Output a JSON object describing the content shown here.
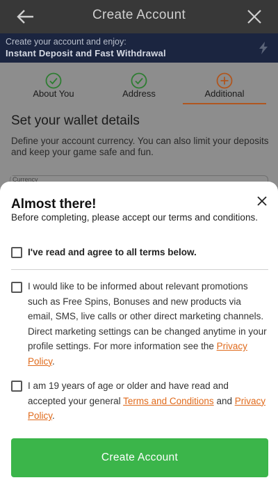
{
  "header": {
    "title": "Create Account"
  },
  "promo": {
    "line1": "Create your account and enjoy:",
    "line2": "Instant Deposit and Fast Withdrawal"
  },
  "steps": [
    {
      "label": "About You",
      "state": "complete"
    },
    {
      "label": "Address",
      "state": "complete"
    },
    {
      "label": "Additional",
      "state": "active"
    }
  ],
  "wallet": {
    "title": "Set your wallet details",
    "description": "Define your account currency. You can also limit your deposits and keep your game safe and fun.",
    "currency_label": "Currency"
  },
  "modal": {
    "title": "Almost there!",
    "subtitle": "Before completing, please accept our terms and conditions.",
    "agree_all": "I've read and agree to all terms below.",
    "marketing": {
      "text": "I would like to be informed about relevant promotions such as Free Spins, Bonuses and new products via email, SMS, live calls or other direct marketing channels. Direct marketing settings can be changed anytime in your profile settings. For more information see the ",
      "link": "Privacy Policy",
      "end": "."
    },
    "age": {
      "text": "I am 19 years of age or older and have read and accepted your general ",
      "link1": "Terms and Conditions",
      "mid": " and ",
      "link2": "Privacy Policy",
      "end": "."
    },
    "button": "Create Account"
  },
  "colors": {
    "accent_orange": "#e06a1b",
    "success_green": "#3bb54a",
    "promo_bg": "#1b2540"
  }
}
